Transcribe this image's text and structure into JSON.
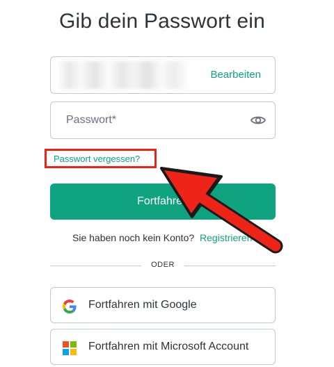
{
  "page": {
    "title": "Gib dein Passwort ein"
  },
  "email": {
    "edit_label": "Bearbeiten"
  },
  "password": {
    "placeholder": "Passwort*",
    "value": ""
  },
  "forgot_password": {
    "label": "Passwort vergessen?"
  },
  "continue_button": {
    "label": "Fortfahren"
  },
  "signup": {
    "prompt": "Sie haben noch kein Konto?",
    "link_label": "Registrieren"
  },
  "divider": {
    "label": "ODER"
  },
  "social": {
    "google_label": "Fortfahren mit Google",
    "microsoft_label": "Fortfahren mit Microsoft Account"
  },
  "colors": {
    "accent": "#10a37f",
    "highlight": "#e8231a",
    "border": "#c2c8d0"
  },
  "icons": {
    "eye": "eye-icon",
    "google": "google-icon",
    "microsoft": "microsoft-icon",
    "annotation": "red-arrow-annotation"
  }
}
